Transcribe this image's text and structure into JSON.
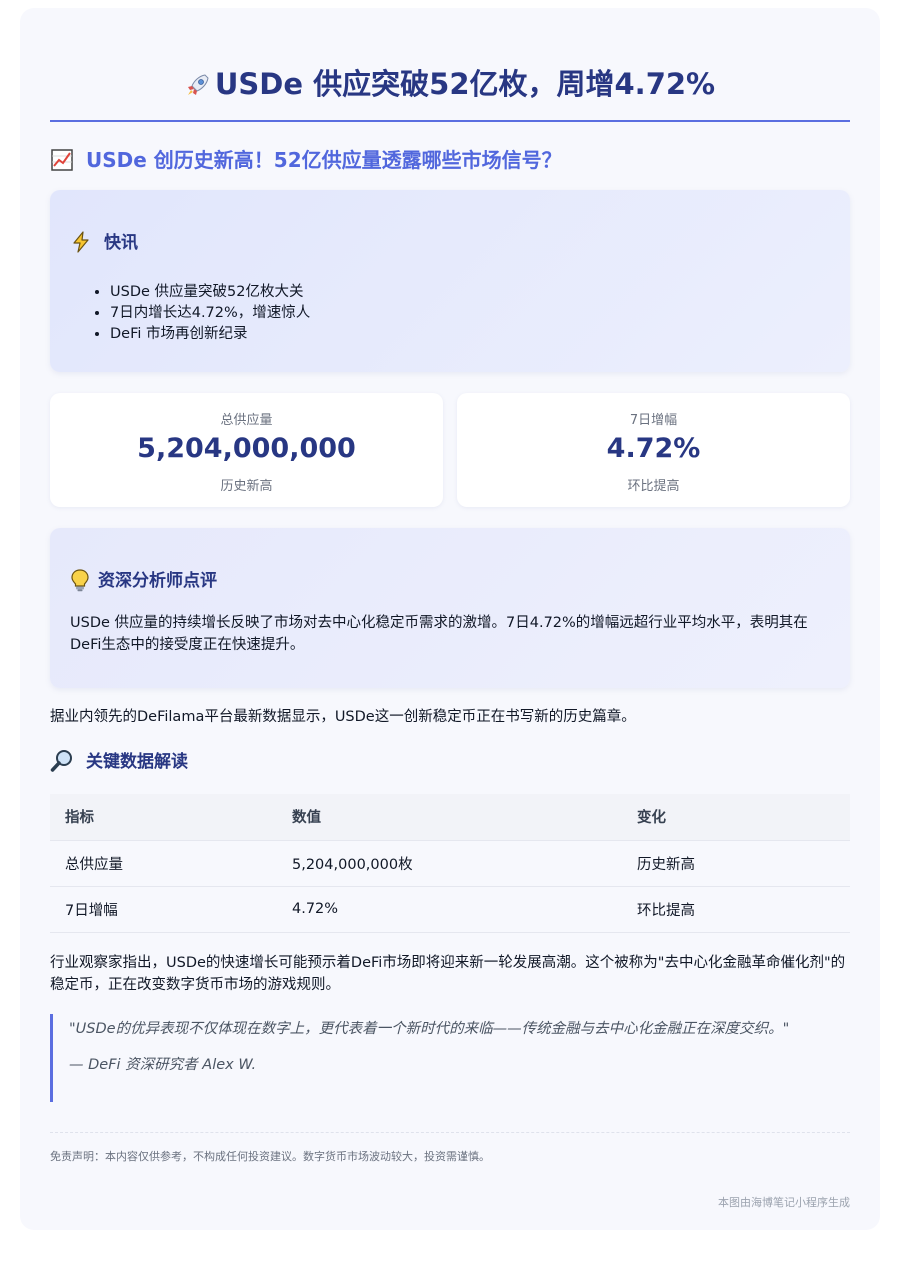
{
  "header": {
    "title": "USDe 供应突破52亿枚，周增4.72%",
    "title_icon": "rocket-icon"
  },
  "subtitle": {
    "text": "USDe 创历史新高！52亿供应量透露哪些市场信号？",
    "icon": "chart-increasing-icon"
  },
  "flash": {
    "title": "快讯",
    "icon": "lightning-icon",
    "items": [
      "USDe 供应量突破52亿枚大关",
      "7日内增长达4.72%，增速惊人",
      "DeFi 市场再创新纪录"
    ]
  },
  "stats": [
    {
      "label": "总供应量",
      "value": "5,204,000,000",
      "note": "历史新高"
    },
    {
      "label": "7日增幅",
      "value": "4.72%",
      "note": "环比提高"
    }
  ],
  "analyst": {
    "title": "资深分析师点评",
    "icon": "lightbulb-icon",
    "text": "USDe 供应量的持续增长反映了市场对去中心化稳定币需求的激增。7日4.72%的增幅远超行业平均水平，表明其在DeFi生态中的接受度正在快速提升。"
  },
  "body": {
    "paragraph1": "据业内领先的DeFilama平台最新数据显示，USDe这一创新稳定币正在书写新的历史篇章。",
    "paragraph2": "行业观察家指出，USDe的快速增长可能预示着DeFi市场即将迎来新一轮发展高潮。这个被称为\"去中心化金融革命催化剂\"的稳定币，正在改变数字货币市场的游戏规则。"
  },
  "key_data": {
    "title": "关键数据解读",
    "icon": "magnifier-icon",
    "headers": [
      "指标",
      "数值",
      "变化"
    ],
    "rows": [
      [
        "总供应量",
        "5,204,000,000枚",
        "历史新高"
      ],
      [
        "7日增幅",
        "4.72%",
        "环比提高"
      ]
    ]
  },
  "quote": {
    "text": "\"USDe的优异表现不仅体现在数字上，更代表着一个新时代的来临——传统金融与去中心化金融正在深度交织。\"",
    "author": "— DeFi 资深研究者 Alex W."
  },
  "disclaimer": "免责声明：本内容仅供参考，不构成任何投资建议。数字货币市场波动较大，投资需谨慎。",
  "footer": "本图由海博笔记小程序生成",
  "colors": {
    "accent": "#5167dd",
    "title": "#283783",
    "card_bg": "#f7f8fd"
  }
}
